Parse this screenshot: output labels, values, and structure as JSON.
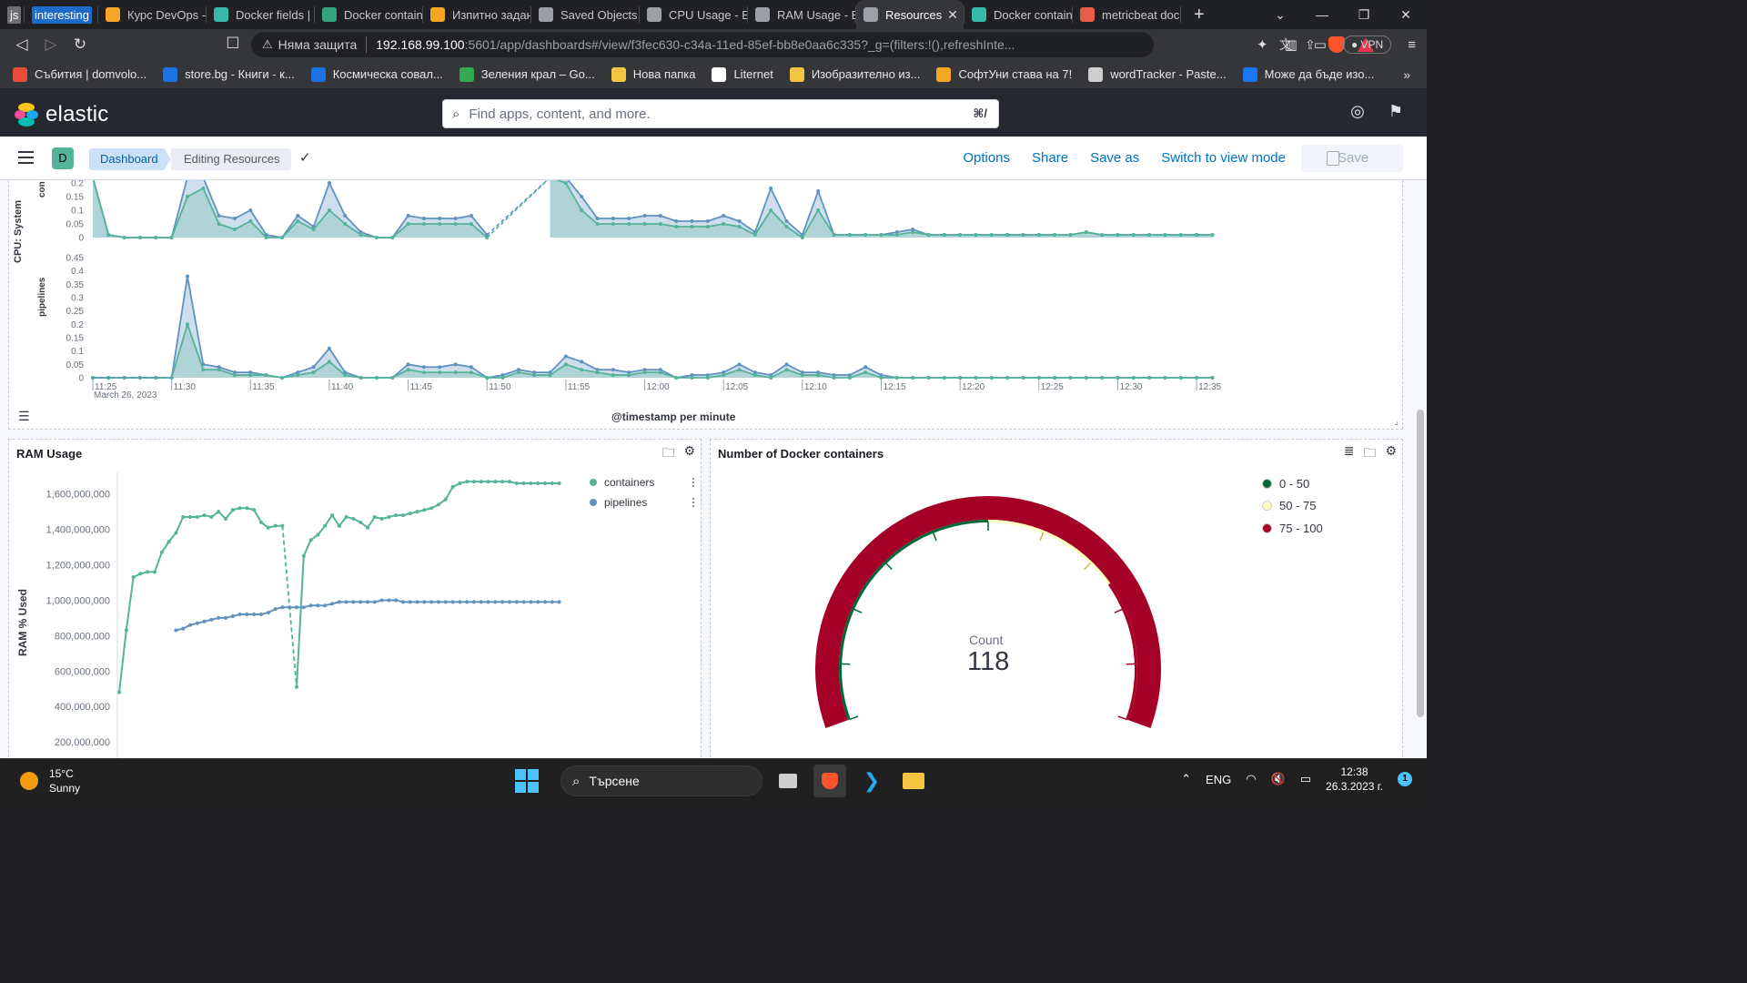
{
  "browser": {
    "tabs": [
      {
        "label": "js",
        "color": "#6e6e6e",
        "pinned": true
      },
      {
        "label": "interesting",
        "color": "#1e6ac9",
        "pinned": true
      },
      {
        "label": "Курс DevOps -",
        "color": "#f5a623"
      },
      {
        "label": "Docker fields |",
        "color": "#36b9a6"
      },
      {
        "label": "Docker contain",
        "color": "#35a57f"
      },
      {
        "label": "Изпитно задан",
        "color": "#f5a623"
      },
      {
        "label": "Saved Objects",
        "color": "#9aa0a6"
      },
      {
        "label": "CPU Usage - El",
        "color": "#9aa0a6"
      },
      {
        "label": "RAM Usage - E",
        "color": "#9aa0a6"
      },
      {
        "label": "Resources",
        "color": "#9aa0a6",
        "active": true
      },
      {
        "label": "Docker contain",
        "color": "#36b9a6"
      },
      {
        "label": "metricbeat doc",
        "color": "#e55d4a"
      }
    ],
    "new_tab": "+",
    "security_label": "Няма защита",
    "url_host": "192.168.99.100",
    "url_path": ":5601/app/dashboards#/view/f3fec630-c34a-11ed-85ef-bb8e0aa6c335?_g=(filters:!(),refreshInte...",
    "vpn_label": "● VPN",
    "bookmarks": [
      {
        "label": "Събития | domvolo...",
        "color": "#e74c3c"
      },
      {
        "label": "store.bg - Книги - к...",
        "color": "#1b74e4"
      },
      {
        "label": "Космическа совал...",
        "color": "#1b74e4"
      },
      {
        "label": "Зеления крал – Go...",
        "color": "#34a853"
      },
      {
        "label": "Нова папка",
        "color": "#f5c542"
      },
      {
        "label": "Liternet",
        "color": "#ffffff"
      },
      {
        "label": "Изобразително из...",
        "color": "#f5c542"
      },
      {
        "label": "СофтУни става на 7!",
        "color": "#f5a623"
      },
      {
        "label": "wordTracker - Paste...",
        "color": "#cfcfcf"
      },
      {
        "label": "Може да бъде изо...",
        "color": "#1877f2"
      }
    ],
    "bookmarks_more": "»"
  },
  "kibana": {
    "brand": "elastic",
    "search_placeholder": "Find apps, content, and more.",
    "search_shortcut": "⌘/",
    "space_initial": "D",
    "breadcrumb_dashboard": "Dashboard",
    "breadcrumb_current": "Editing Resources",
    "nav": {
      "options": "Options",
      "share": "Share",
      "save_as": "Save as",
      "switch": "Switch to view mode",
      "save": "Save"
    }
  },
  "cpu_panel": {
    "y_label": "CPU: System",
    "facet_top": "con",
    "facet_bottom": "pipelines",
    "x_title": "@timestamp per minute",
    "date_label": "March 26, 2023"
  },
  "ram_panel": {
    "title": "RAM Usage",
    "y_label": "RAM % Used"
  },
  "gauge_panel": {
    "title": "Number of Docker containers",
    "metric_label": "Count",
    "metric_value": "118",
    "legend": [
      {
        "label": "0 - 50",
        "color": "#006837"
      },
      {
        "label": "50 - 75",
        "color": "#ffffbf"
      },
      {
        "label": "75 - 100",
        "color": "#a50026"
      }
    ]
  },
  "chart_data": [
    {
      "type": "area",
      "title": "",
      "facet": "con",
      "ylabel": "CPU: System",
      "xlabel": "@timestamp per minute",
      "yticks": [
        "0",
        "0.05",
        "0.1",
        "0.15",
        "0.2"
      ],
      "x": [
        "11:25",
        "11:26",
        "11:27",
        "11:28",
        "11:29",
        "11:30",
        "11:31",
        "11:32",
        "11:33",
        "11:34",
        "11:35",
        "11:36",
        "11:37",
        "11:38",
        "11:39",
        "11:40",
        "11:41",
        "11:42",
        "11:43",
        "11:44",
        "11:45",
        "11:46",
        "11:47",
        "11:48",
        "11:49",
        "11:50",
        "11:51",
        "11:52",
        "11:53",
        "11:54",
        "11:55",
        "11:56",
        "11:57",
        "11:58",
        "11:59",
        "12:00",
        "12:01",
        "12:02",
        "12:03",
        "12:04",
        "12:05",
        "12:06",
        "12:07",
        "12:08",
        "12:09",
        "12:10",
        "12:11",
        "12:12",
        "12:13",
        "12:14",
        "12:15",
        "12:16",
        "12:17",
        "12:18",
        "12:19",
        "12:20",
        "12:21",
        "12:22",
        "12:23",
        "12:24",
        "12:25",
        "12:26",
        "12:27",
        "12:28",
        "12:29",
        "12:30",
        "12:31",
        "12:32",
        "12:33",
        "12:34",
        "12:35",
        "12:36"
      ],
      "series": [
        {
          "name": "pipelines",
          "color": "#6092c0",
          "values": [
            0.3,
            0.01,
            0,
            0,
            0,
            0,
            0.25,
            0.28,
            0.08,
            0.07,
            0.1,
            0.01,
            0,
            0.08,
            0.04,
            0.2,
            0.08,
            0.02,
            0,
            0,
            0.08,
            0.07,
            0.07,
            0.07,
            0.08,
            0.01,
            null,
            null,
            null,
            0.28,
            0.25,
            0.15,
            0.07,
            0.07,
            0.07,
            0.08,
            0.08,
            0.06,
            0.06,
            0.06,
            0.08,
            0.06,
            0.02,
            0.18,
            0.06,
            0.01,
            0.17,
            0.01,
            0.01,
            0.01,
            0.01,
            0.02,
            0.03,
            0.01,
            0.01,
            0.01,
            0.01,
            0.01,
            0.01,
            0.01,
            0.01,
            0.01,
            0.01,
            0.02,
            0.01,
            0.01,
            0.01,
            0.01,
            0.01,
            0.01,
            0.01,
            0.01
          ]
        },
        {
          "name": "containers",
          "color": "#54b399",
          "values": [
            0.25,
            0.01,
            0,
            0,
            0,
            0,
            0.15,
            0.18,
            0.05,
            0.03,
            0.06,
            0,
            0,
            0.06,
            0.03,
            0.1,
            0.05,
            0.01,
            0,
            0,
            0.05,
            0.05,
            0.05,
            0.05,
            0.05,
            0,
            null,
            null,
            null,
            0.22,
            0.2,
            0.1,
            0.05,
            0.05,
            0.05,
            0.05,
            0.05,
            0.04,
            0.04,
            0.04,
            0.05,
            0.04,
            0.01,
            0.1,
            0.04,
            0,
            0.1,
            0.01,
            0.01,
            0.01,
            0.01,
            0.01,
            0.02,
            0.01,
            0.01,
            0.01,
            0.01,
            0.01,
            0.01,
            0.01,
            0.01,
            0.01,
            0.01,
            0.02,
            0.01,
            0.01,
            0.01,
            0.01,
            0.01,
            0.01,
            0.01,
            0.01
          ]
        }
      ]
    },
    {
      "type": "area",
      "title": "",
      "facet": "pipelines",
      "ylabel": "CPU: System",
      "xlabel": "@timestamp per minute",
      "yticks": [
        "0",
        "0.05",
        "0.1",
        "0.15",
        "0.2",
        "0.25",
        "0.3",
        "0.35",
        "0.4",
        "0.45"
      ],
      "xticks": [
        "11:25",
        "11:30",
        "11:35",
        "11:40",
        "11:45",
        "11:50",
        "11:55",
        "12:00",
        "12:05",
        "12:10",
        "12:15",
        "12:20",
        "12:25",
        "12:30",
        "12:35"
      ],
      "x": [
        "11:25",
        "11:26",
        "11:27",
        "11:28",
        "11:29",
        "11:30",
        "11:31",
        "11:32",
        "11:33",
        "11:34",
        "11:35",
        "11:36",
        "11:37",
        "11:38",
        "11:39",
        "11:40",
        "11:41",
        "11:42",
        "11:43",
        "11:44",
        "11:45",
        "11:46",
        "11:47",
        "11:48",
        "11:49",
        "11:50",
        "11:51",
        "11:52",
        "11:53",
        "11:54",
        "11:55",
        "11:56",
        "11:57",
        "11:58",
        "11:59",
        "12:00",
        "12:01",
        "12:02",
        "12:03",
        "12:04",
        "12:05",
        "12:06",
        "12:07",
        "12:08",
        "12:09",
        "12:10",
        "12:11",
        "12:12",
        "12:13",
        "12:14",
        "12:15",
        "12:16",
        "12:17",
        "12:18",
        "12:19",
        "12:20",
        "12:21",
        "12:22",
        "12:23",
        "12:24",
        "12:25",
        "12:26",
        "12:27",
        "12:28",
        "12:29",
        "12:30",
        "12:31",
        "12:32",
        "12:33",
        "12:34",
        "12:35",
        "12:36"
      ],
      "series": [
        {
          "name": "pipelines",
          "color": "#6092c0",
          "values": [
            0,
            0,
            0,
            0,
            0,
            0,
            0.38,
            0.05,
            0.04,
            0.02,
            0.02,
            0.01,
            0,
            0.02,
            0.04,
            0.11,
            0.02,
            0,
            0,
            0,
            0.05,
            0.04,
            0.04,
            0.05,
            0.04,
            0,
            0.01,
            0.03,
            0.02,
            0.02,
            0.08,
            0.06,
            0.03,
            0.03,
            0.02,
            0.03,
            0.03,
            0,
            0.01,
            0.01,
            0.02,
            0.05,
            0.02,
            0.01,
            0.05,
            0.02,
            0.02,
            0.01,
            0.01,
            0.04,
            0.01,
            0,
            0,
            0,
            0,
            0,
            0,
            0,
            0,
            0,
            0,
            0,
            0,
            0,
            0,
            0,
            0,
            0,
            0,
            0,
            0,
            0
          ]
        },
        {
          "name": "containers",
          "color": "#54b399",
          "values": [
            0,
            0,
            0,
            0,
            0,
            0,
            0.2,
            0.03,
            0.03,
            0.01,
            0.01,
            0.01,
            0,
            0.01,
            0.02,
            0.06,
            0.01,
            0,
            0,
            0,
            0.03,
            0.02,
            0.02,
            0.02,
            0.02,
            0,
            0,
            0.02,
            0.01,
            0.01,
            0.05,
            0.03,
            0.02,
            0.01,
            0.01,
            0.02,
            0.02,
            0,
            0,
            0,
            0.01,
            0.03,
            0.01,
            0,
            0.03,
            0.01,
            0.01,
            0,
            0,
            0.02,
            0,
            0,
            0,
            0,
            0,
            0,
            0,
            0,
            0,
            0,
            0,
            0,
            0,
            0,
            0,
            0,
            0,
            0,
            0,
            0,
            0,
            0
          ]
        }
      ],
      "date_label": "March 26, 2023"
    },
    {
      "type": "line",
      "title": "RAM Usage",
      "ylabel": "RAM % Used",
      "yticks": [
        "200,000,000",
        "400,000,000",
        "600,000,000",
        "800,000,000",
        "1,000,000,000",
        "1,200,000,000",
        "1,400,000,000",
        "1,600,000,000"
      ],
      "legend_position": "top-right",
      "series": [
        {
          "name": "containers",
          "color": "#54b399",
          "values": [
            480000000,
            830000000,
            1130000000,
            1150000000,
            1160000000,
            1160000000,
            1270000000,
            1330000000,
            1380000000,
            1470000000,
            1470000000,
            1470000000,
            1480000000,
            1470000000,
            1500000000,
            1460000000,
            1510000000,
            1520000000,
            1520000000,
            1510000000,
            1440000000,
            1410000000,
            1420000000,
            1420000000,
            null,
            510000000,
            1250000000,
            1340000000,
            1370000000,
            1420000000,
            1480000000,
            1420000000,
            1470000000,
            1460000000,
            1440000000,
            1410000000,
            1470000000,
            1460000000,
            1470000000,
            1480000000,
            1480000000,
            1490000000,
            1500000000,
            1510000000,
            1520000000,
            1540000000,
            1570000000,
            1640000000,
            1660000000,
            1670000000,
            1670000000,
            1670000000,
            1670000000,
            1670000000,
            1670000000,
            1670000000,
            1660000000,
            1660000000,
            1660000000,
            1660000000,
            1660000000,
            1660000000,
            1660000000
          ]
        },
        {
          "name": "pipelines",
          "color": "#6092c0",
          "values": [
            null,
            null,
            null,
            null,
            null,
            null,
            null,
            null,
            830000000,
            840000000,
            860000000,
            870000000,
            880000000,
            890000000,
            900000000,
            900000000,
            910000000,
            920000000,
            920000000,
            920000000,
            920000000,
            930000000,
            950000000,
            960000000,
            960000000,
            960000000,
            960000000,
            970000000,
            970000000,
            970000000,
            980000000,
            990000000,
            990000000,
            990000000,
            990000000,
            990000000,
            990000000,
            1000000000,
            1000000000,
            1000000000,
            990000000,
            990000000,
            990000000,
            990000000,
            990000000,
            990000000,
            990000000,
            990000000,
            990000000,
            990000000,
            990000000,
            990000000,
            990000000,
            990000000,
            990000000,
            990000000,
            990000000,
            990000000,
            990000000,
            990000000,
            990000000,
            990000000,
            990000000
          ]
        }
      ],
      "ylim": [
        0,
        1700000000
      ]
    },
    {
      "type": "gauge",
      "title": "Number of Docker containers",
      "metric": "Count",
      "value": 118,
      "range": [
        0,
        100
      ],
      "bands": [
        {
          "label": "0 - 50",
          "color": "#006837"
        },
        {
          "label": "50 - 75",
          "color": "#ffffbf"
        },
        {
          "label": "75 - 100",
          "color": "#a50026"
        }
      ]
    }
  ],
  "taskbar": {
    "temperature": "15°C",
    "weather": "Sunny",
    "search_label": "Търсене",
    "language": "ENG",
    "time": "12:38",
    "date": "26.3.2023 г.",
    "notifications": "1"
  }
}
